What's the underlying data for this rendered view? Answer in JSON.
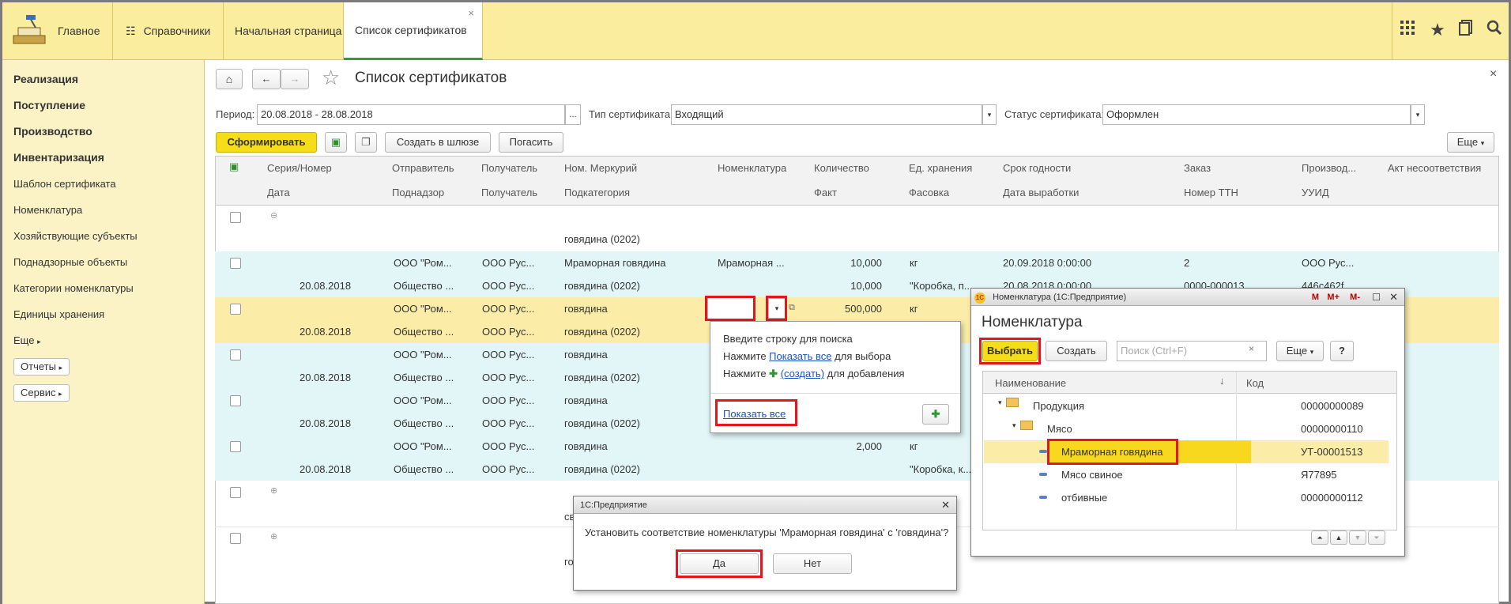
{
  "topbar": {
    "home_label": "Главное",
    "catalogs_label": "Справочники",
    "tabs": [
      {
        "label": "Начальная страница"
      },
      {
        "label": "Список сертификатов",
        "close": "×"
      }
    ],
    "icons": [
      "apps-grid-icon",
      "star-icon",
      "history-icon",
      "search-icon"
    ]
  },
  "sidebar": {
    "bold_items": [
      "Реализация",
      "Поступление",
      "Производство",
      "Инвентаризация"
    ],
    "items": [
      "Шаблон сертификата",
      "Номенклатура",
      "Хозяйствующие субъекты",
      "Поднадзорные объекты",
      "Категории номенклатуры",
      "Единицы хранения"
    ],
    "more_label": "Еще",
    "buttons": [
      "Отчеты",
      "Сервис"
    ]
  },
  "main": {
    "title": "Список сертификатов",
    "close": "×",
    "period_label": "Период:",
    "period_value": "20.08.2018 - 28.08.2018",
    "type_label": "Тип сертификата:",
    "type_value": "Входящий",
    "status_label": "Статус сертификата:",
    "status_value": "Оформлен",
    "btn_form": "Сформировать",
    "btn_create_gateway": "Создать в шлюзе",
    "btn_redeem": "Погасить",
    "btn_more": "Еще"
  },
  "table": {
    "headers_row1": [
      "Серия/Номер",
      "Отправитель",
      "Получатель",
      "Ном. Меркурий",
      "Номенклатура",
      "Количество",
      "Ед. хранения",
      "Срок годности",
      "Заказ",
      "Производ...",
      "Акт несоответствия"
    ],
    "headers_row2": [
      "Дата",
      "Поднадзор",
      "Получатель",
      "Подкатегория",
      "",
      "Факт",
      "Фасовка",
      "Дата выработки",
      "Номер ТТН",
      "УУИД"
    ],
    "group_sub": "говядина (0202)",
    "rows": [
      {
        "date": "20.08.2018",
        "sender": "ООО \"Ром...",
        "sender2": "Общество ...",
        "recipient": "ООО Рус...",
        "recipient2": "ООО Рус...",
        "merc": "Мраморная говядина",
        "merc2": "говядина (0202)",
        "nomen": "Мраморная ...",
        "qty": "10,000",
        "fact": "10,000",
        "unit": "кг",
        "pack": "\"Коробка, п...",
        "expiry": "20.09.2018 0:00:00",
        "prod_date": "20.08.2018 0:00:00",
        "order": "2",
        "ttn": "0000-000013",
        "maker": "ООО Рус...",
        "uuid": "446c462f..."
      },
      {
        "date": "20.08.2018",
        "sender": "ООО \"Ром...",
        "sender2": "Общество ...",
        "recipient": "ООО Рус...",
        "recipient2": "ООО Рус...",
        "merc": "говядина",
        "merc2": "говядина (0202)",
        "qty": "500,000",
        "unit": "кг"
      },
      {
        "date": "20.08.2018",
        "sender": "ООО \"Ром...",
        "sender2": "Общество ...",
        "recipient": "ООО Рус...",
        "recipient2": "ООО Рус...",
        "merc": "говядина",
        "merc2": "говядина (0202)"
      },
      {
        "date": "20.08.2018",
        "sender": "ООО \"Ром...",
        "sender2": "Общество ...",
        "recipient": "ООО Рус...",
        "recipient2": "ООО Рус...",
        "merc": "говядина",
        "merc2": "говядина (0202)"
      },
      {
        "date": "20.08.2018",
        "sender": "ООО \"Ром...",
        "sender2": "Общество ...",
        "recipient": "ООО Рус...",
        "recipient2": "ООО Рус...",
        "merc": "говядина",
        "merc2": "говядина (0202)",
        "qty": "2,000",
        "unit": "кг",
        "pack": "\"Коробка, к..."
      }
    ],
    "partial_a": "св",
    "partial_b": "го"
  },
  "dropdown": {
    "line1": "Введите строку для поиска",
    "line2_pre": "Нажмите ",
    "line2_link": "Показать все",
    "line2_post": " для выбора",
    "line3_pre": "Нажмите ",
    "line3_link": "(создать)",
    "line3_post": " для добавления",
    "show_all": "Показать все"
  },
  "nomen_window": {
    "titlebar": "Номенклатура (1С:Предприятие)",
    "title": "Номенклатура",
    "btn_select": "Выбрать",
    "btn_create": "Создать",
    "search_placeholder": "Поиск (Ctrl+F)",
    "btn_more": "Еще",
    "btn_help": "?",
    "col_name": "Наименование",
    "col_code": "Код",
    "tree": [
      {
        "name": "Продукция",
        "code": "00000000089"
      },
      {
        "name": "Мясо",
        "code": "00000000110"
      },
      {
        "name": "Мраморная говядина",
        "code": "УТ-00001513"
      },
      {
        "name": "Мясо свиное",
        "code": "Я77895"
      },
      {
        "name": "отбивные",
        "code": "00000000112"
      }
    ],
    "title_controls": [
      "M",
      "M+",
      "M-"
    ]
  },
  "confirm": {
    "titlebar": "1С:Предприятие",
    "message": "Установить соответствие номенклатуры 'Мраморная говядина' с 'говядина'?",
    "yes": "Да",
    "no": "Нет"
  }
}
